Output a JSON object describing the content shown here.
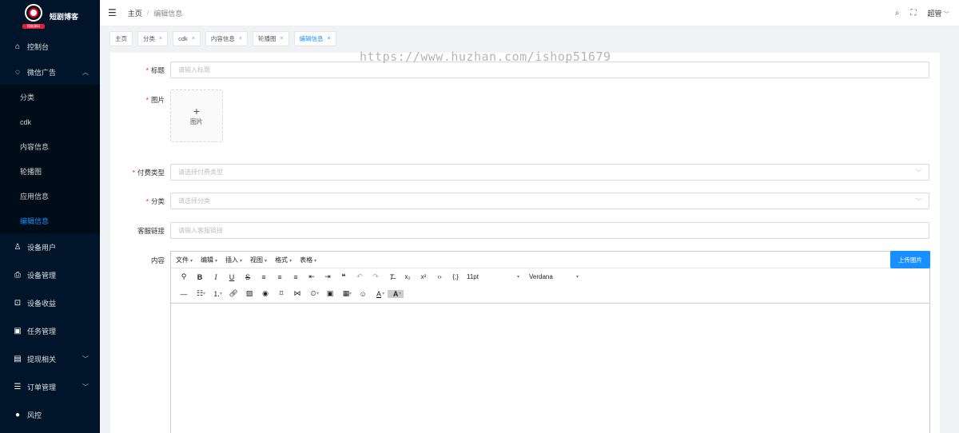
{
  "app": {
    "logo_text": "短剧博客",
    "logo_ribbon": "短剧源码"
  },
  "sidebar": {
    "items": [
      {
        "label": "控制台",
        "icon": "home-icon"
      },
      {
        "label": "微信广告",
        "icon": "chat-icon",
        "expanded": true,
        "children": [
          "分类",
          "cdk",
          "内容信息",
          "轮播图",
          "应用信息",
          "编辑信息"
        ],
        "active_child": "编辑信息"
      },
      {
        "label": "设备用户",
        "icon": "user-icon"
      },
      {
        "label": "设备管理",
        "icon": "printer-icon"
      },
      {
        "label": "设备收益",
        "icon": "cart-icon"
      },
      {
        "label": "任务管理",
        "icon": "clipboard-check-icon"
      },
      {
        "label": "提现相关",
        "icon": "clipboard-icon",
        "has_arrow": true
      },
      {
        "label": "订单管理",
        "icon": "sliders-icon",
        "has_arrow": true
      },
      {
        "label": "风控",
        "icon": "alert-icon"
      }
    ],
    "bg_color": "#001529",
    "active_color": "#1890ff"
  },
  "header": {
    "breadcrumb_home": "主页",
    "breadcrumb_sep": "/",
    "breadcrumb_current": "编辑信息",
    "user_name": "超管"
  },
  "tabs": [
    {
      "label": "主页",
      "closable": false
    },
    {
      "label": "分类",
      "closable": true
    },
    {
      "label": "cdk",
      "closable": true
    },
    {
      "label": "内容信息",
      "closable": true
    },
    {
      "label": "轮播图",
      "closable": true
    },
    {
      "label": "编辑信息",
      "closable": true,
      "active": true
    }
  ],
  "form": {
    "title_label": "标题",
    "title_placeholder": "请输入标题",
    "image_label": "图片",
    "image_upload_text": "图片",
    "pay_type_label": "付费类型",
    "pay_type_placeholder": "请选择付费类型",
    "category_label": "分类",
    "category_placeholder": "请选择分类",
    "service_link_label": "客服链接",
    "service_link_placeholder": "请输入客服链接",
    "content_label": "内容"
  },
  "editor": {
    "menus": [
      "文件",
      "编辑",
      "插入",
      "视图",
      "格式",
      "表格"
    ],
    "upload_button": "上传图片",
    "font_size": "11pt",
    "font_family": "Verdana"
  },
  "watermark": "https://www.huzhan.com/ishop51679"
}
